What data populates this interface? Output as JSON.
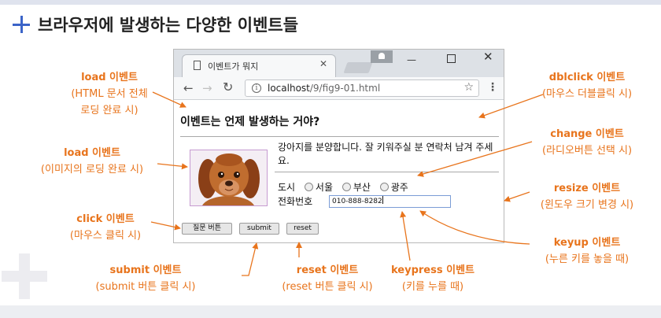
{
  "slide": {
    "title": "브라우저에 발생하는 다양한 이벤트들"
  },
  "browser": {
    "tab_title": "이벤트가 뭐지",
    "url_host": "localhost",
    "url_path": "/9/fig9-01.html"
  },
  "page": {
    "heading": "이벤트는 언제 발생하는 거야?",
    "description": "강아지를 분양합니다. 잘 키워주실 분 연락처 남겨 주세요.",
    "city_label": "도시",
    "city_options": [
      "서울",
      "부산",
      "광주"
    ],
    "phone_label": "전화번호",
    "phone_value": "010-888-8282",
    "buttons": {
      "question": "질문 버튼",
      "submit": "submit",
      "reset": "reset"
    }
  },
  "annotations": {
    "load_page": {
      "title": "load 이벤트",
      "sub1": "(HTML 문서 전체",
      "sub2": "로딩 완료 시)"
    },
    "load_image": {
      "title": "load 이벤트",
      "sub": "(이미지의 로딩 완료 시)"
    },
    "click": {
      "title": "click 이벤트",
      "sub": "(마우스 클릭 시)"
    },
    "submit": {
      "title": "submit 이벤트",
      "sub": "(submit 버튼 클릭 시)"
    },
    "reset": {
      "title": "reset 이벤트",
      "sub": "(reset 버튼 클릭 시)"
    },
    "keypress": {
      "title": "keypress 이벤트",
      "sub": "(키를 누를 때)"
    },
    "dblclick": {
      "title": "dblclick 이벤트",
      "sub": "(마우스 더블클릭 시)"
    },
    "change": {
      "title": "change 이벤트",
      "sub": "(라디오버튼 선택 시)"
    },
    "resize": {
      "title": "resize 이벤트",
      "sub": "(윈도우 크기 변경 시)"
    },
    "keyup": {
      "title": "keyup 이벤트",
      "sub": "(누른 키를 놓을 때)"
    }
  },
  "colors": {
    "annotation": "#e8741c",
    "title_plus": "#3b64c8"
  },
  "icons": [
    "plus-icon",
    "page-icon",
    "close-icon",
    "back-icon",
    "forward-icon",
    "reload-icon",
    "info-icon",
    "star-icon",
    "menu-icon",
    "user-icon"
  ]
}
